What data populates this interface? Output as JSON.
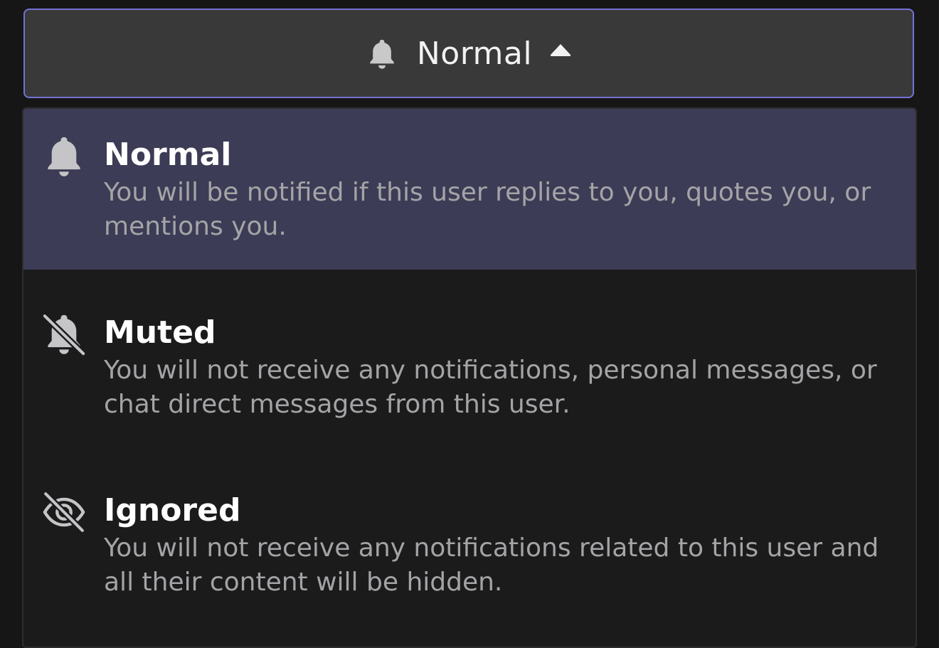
{
  "select": {
    "icon": "bell-icon",
    "value": "Normal",
    "caret": "caret-up-icon",
    "accent_color": "#7472d6"
  },
  "options": [
    {
      "icon": "bell-icon",
      "title": "Normal",
      "description": "You will be notified if this user replies to you, quotes you, or mentions you.",
      "selected": true
    },
    {
      "icon": "bell-slash-icon",
      "title": "Muted",
      "description": "You will not receive any notifications, personal messages, or chat direct messages from this user.",
      "selected": false
    },
    {
      "icon": "eye-slash-icon",
      "title": "Ignored",
      "description": "You will not receive any notifications related to this user and all their content will be hidden.",
      "selected": false
    }
  ]
}
